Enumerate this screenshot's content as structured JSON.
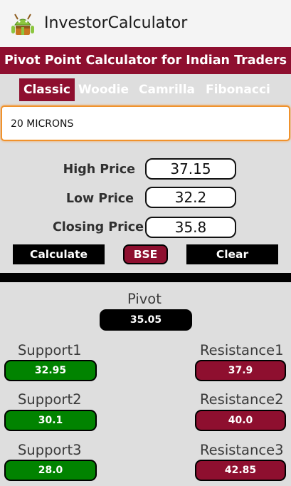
{
  "app": {
    "title": "InvestorCalculator"
  },
  "banner": {
    "text": "Pivot Point Calculator for Indian Traders"
  },
  "tabs": [
    {
      "label": "Classic",
      "active": true
    },
    {
      "label": "Woodie",
      "active": false
    },
    {
      "label": "Camrilla",
      "active": false
    },
    {
      "label": "Fibonacci",
      "active": false
    }
  ],
  "stock_field": {
    "value": "20 MICRONS"
  },
  "inputs": {
    "high": {
      "label": "High Price",
      "value": "37.15"
    },
    "low": {
      "label": "Low Price",
      "value": "32.2"
    },
    "close": {
      "label": "Closing Price",
      "value": "35.8"
    }
  },
  "buttons": {
    "calculate": "Calculate",
    "exchange": "BSE",
    "clear": "Clear"
  },
  "results": {
    "pivot": {
      "label": "Pivot",
      "value": "35.05"
    },
    "support1": {
      "label": "Support1",
      "value": "32.95"
    },
    "support2": {
      "label": "Support2",
      "value": "30.1"
    },
    "support3": {
      "label": "Support3",
      "value": "28.0"
    },
    "resistance1": {
      "label": "Resistance1",
      "value": "37.9"
    },
    "resistance2": {
      "label": "Resistance2",
      "value": "40.0"
    },
    "resistance3": {
      "label": "Resistance3",
      "value": "42.85"
    }
  },
  "colors": {
    "accent": "#8e0f2f",
    "support": "#018300",
    "focus_border": "#f0922c",
    "background": "#dedede"
  },
  "icons": {
    "app_icon": "android-robot-icon"
  }
}
